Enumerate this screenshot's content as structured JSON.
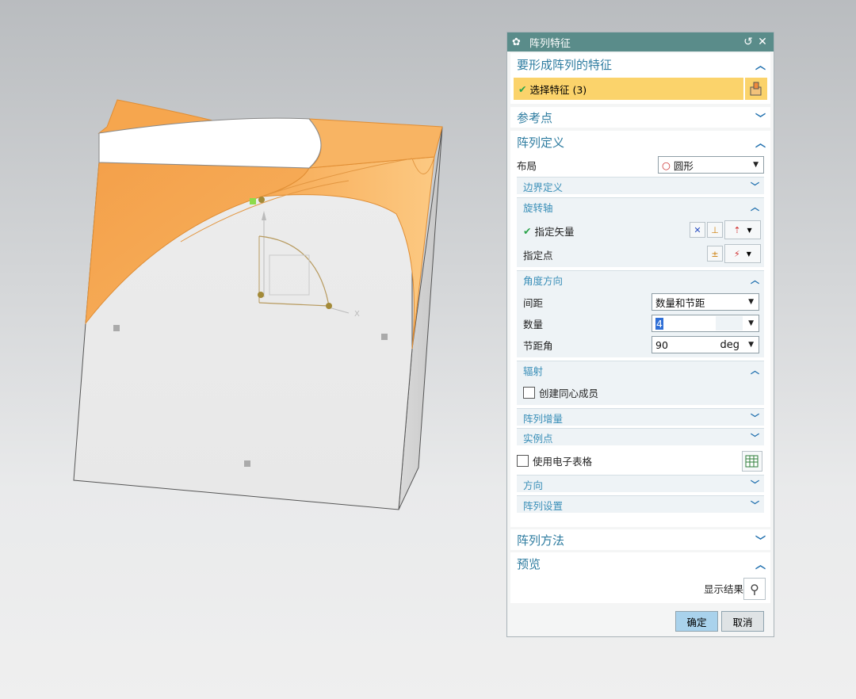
{
  "dialog": {
    "title": "阵列特征",
    "title_icon": "gear-icon",
    "reset_icon": "reset-icon",
    "close_icon": "close-icon"
  },
  "features_section": {
    "title": "要形成阵列的特征",
    "select_label": "选择特征 (3)",
    "highlight_color": "#fbd36b"
  },
  "reference_point": {
    "title": "参考点"
  },
  "array_definition": {
    "title": "阵列定义",
    "layout_label": "布局",
    "layout_value": "圆形",
    "boundary": {
      "title": "边界定义"
    },
    "rotation_axis": {
      "title": "旋转轴",
      "specify_vector": "指定矢量",
      "specify_point": "指定点"
    },
    "angle_direction": {
      "title": "角度方向",
      "spacing_label": "间距",
      "spacing_value": "数量和节距",
      "count_label": "数量",
      "count_value": "4",
      "pitch_label": "节距角",
      "pitch_value": "90",
      "pitch_unit": "deg"
    },
    "radiate": {
      "title": "辐射",
      "concentric_label": "创建同心成员"
    },
    "increment": {
      "title": "阵列增量"
    },
    "instance_point": {
      "title": "实例点"
    },
    "spreadsheet_label": "使用电子表格",
    "orientation": {
      "title": "方向"
    },
    "settings": {
      "title": "阵列设置"
    }
  },
  "array_method": {
    "title": "阵列方法"
  },
  "preview": {
    "title": "预览",
    "show_result": "显示结果"
  },
  "buttons": {
    "ok": "确定",
    "cancel": "取消"
  },
  "colors": {
    "title_bar": "#5a8c8a",
    "header_text": "#2e7ca0",
    "accent_orange": "#f5a148",
    "ok_button": "#a9d2ec"
  }
}
